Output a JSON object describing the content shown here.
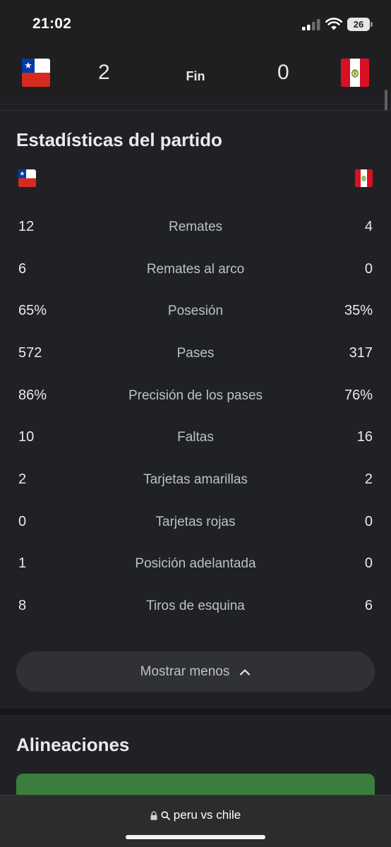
{
  "status_bar": {
    "time": "21:02",
    "battery": "26",
    "icons": [
      "signal-icon",
      "wifi-icon",
      "battery-icon"
    ]
  },
  "match": {
    "home_team_flag": "chile-flag-icon",
    "away_team_flag": "peru-flag-icon",
    "home_score": "2",
    "away_score": "0",
    "status": "Fin"
  },
  "stats": {
    "title": "Estadísticas del partido",
    "rows": [
      {
        "home": "12",
        "label": "Remates",
        "away": "4"
      },
      {
        "home": "6",
        "label": "Remates al arco",
        "away": "0"
      },
      {
        "home": "65%",
        "label": "Posesión",
        "away": "35%"
      },
      {
        "home": "572",
        "label": "Pases",
        "away": "317"
      },
      {
        "home": "86%",
        "label": "Precisión de los pases",
        "away": "76%"
      },
      {
        "home": "10",
        "label": "Faltas",
        "away": "16"
      },
      {
        "home": "2",
        "label": "Tarjetas amarillas",
        "away": "2"
      },
      {
        "home": "0",
        "label": "Tarjetas rojas",
        "away": "0"
      },
      {
        "home": "1",
        "label": "Posición adelantada",
        "away": "0"
      },
      {
        "home": "8",
        "label": "Tiros de esquina",
        "away": "6"
      }
    ],
    "show_less_label": "Mostrar menos"
  },
  "lineups": {
    "title": "Alineaciones",
    "preview_color": "#3a7d3d"
  },
  "url_bar": {
    "query": "peru vs chile"
  },
  "colors": {
    "background": "#202124",
    "chile_red": "#d52b1e",
    "chile_blue": "#0039a6",
    "peru_red": "#d91023"
  }
}
